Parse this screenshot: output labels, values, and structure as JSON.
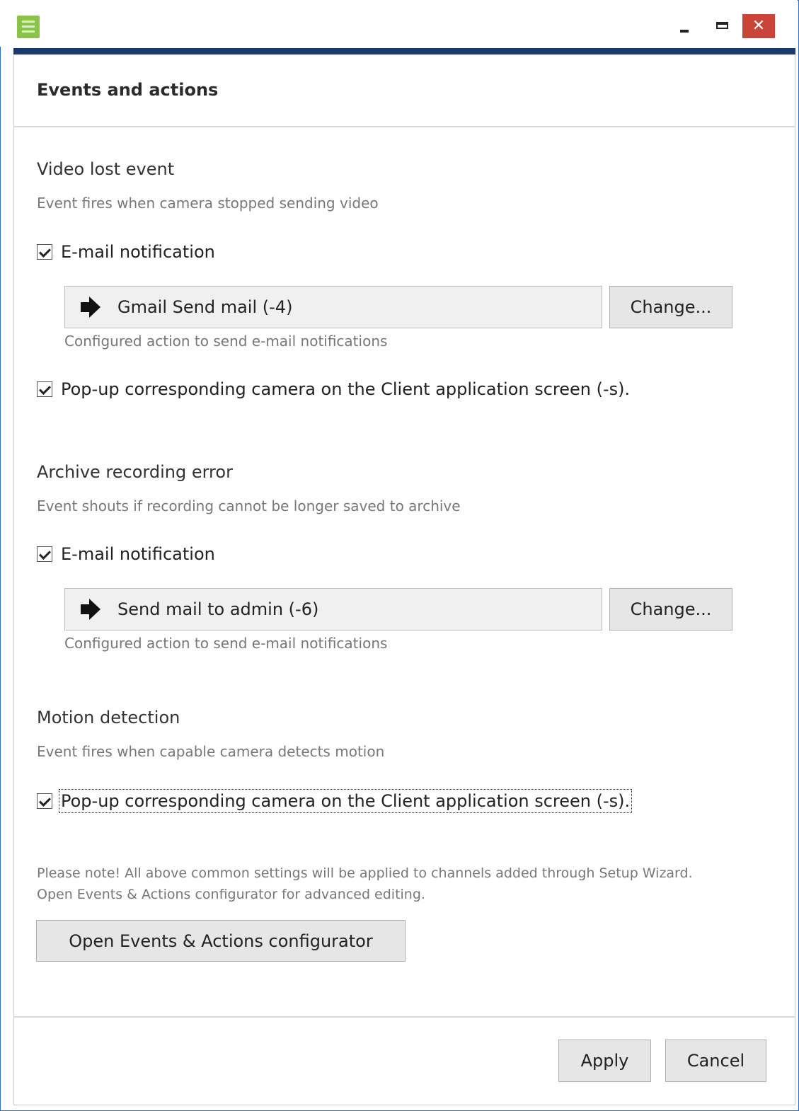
{
  "window": {
    "icon": "app-list-icon",
    "controls": {
      "minimize": "minimize-icon",
      "maximize": "maximize-icon",
      "close_glyph": "✕"
    },
    "accent_color": "#1b3a6b",
    "close_color": "#c9453a"
  },
  "header": {
    "title": "Events and actions"
  },
  "sections": [
    {
      "title": "Video lost event",
      "description": "Event fires when camera stopped sending video",
      "email_checkbox": {
        "label": "E-mail notification",
        "checked": true
      },
      "action": {
        "icon": "arrow-right-icon",
        "label": "Gmail Send mail (-4)",
        "change_label": "Change...",
        "hint": "Configured action to send e-mail notifications"
      },
      "popup_checkbox": {
        "label": "Pop-up corresponding camera on the Client application screen (-s).",
        "checked": true
      }
    },
    {
      "title": "Archive recording error",
      "description": "Event shouts if recording cannot be longer saved to archive",
      "email_checkbox": {
        "label": "E-mail notification",
        "checked": true
      },
      "action": {
        "icon": "arrow-right-icon",
        "label": "Send mail to admin (-6)",
        "change_label": "Change...",
        "hint": "Configured action to send e-mail notifications"
      }
    },
    {
      "title": "Motion detection",
      "description": "Event fires when capable camera detects motion",
      "popup_checkbox": {
        "label": "Pop-up corresponding camera on the Client application screen (-s).",
        "checked": true
      }
    }
  ],
  "note": {
    "line1": "Please note! All above common settings will be applied to channels added through Setup Wizard.",
    "line2": "Open Events & Actions configurator for advanced editing."
  },
  "configurator_button": "Open Events & Actions configurator",
  "footer": {
    "apply_label": "Apply",
    "cancel_label": "Cancel"
  }
}
